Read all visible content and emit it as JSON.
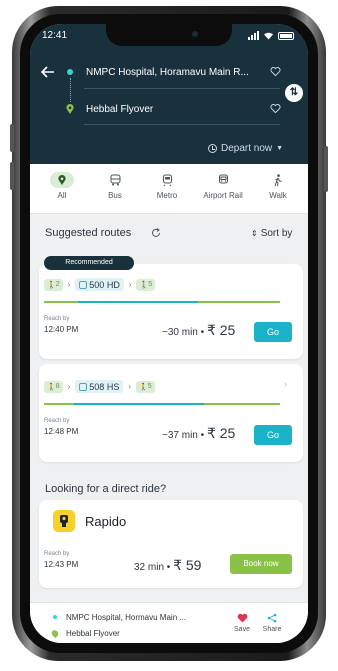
{
  "status_bar": {
    "time": "12:41"
  },
  "header": {
    "source": "NMPC Hospital, Horamavu Main R...",
    "destination": "Hebbal Flyover",
    "depart_label": "Depart now",
    "bg_color": "#19313d"
  },
  "modes": [
    {
      "label": "All",
      "icon": "pin-icon",
      "active": true
    },
    {
      "label": "Bus",
      "icon": "bus-icon",
      "active": false
    },
    {
      "label": "Metro",
      "icon": "metro-icon",
      "active": false
    },
    {
      "label": "Airport Rail",
      "icon": "airport-rail-icon",
      "active": false
    },
    {
      "label": "Walk",
      "icon": "walk-icon",
      "active": false
    }
  ],
  "suggested": {
    "title": "Suggested routes",
    "sort_label": "Sort by"
  },
  "routes": [
    {
      "badge": "Recommended",
      "walk_start": "2",
      "bus": "500 HD",
      "walk_end": "5",
      "reach_label": "Reach by",
      "reach_time": "12:40 PM",
      "duration": "~30 min",
      "dot": "•",
      "fare": "₹ 25",
      "go_label": "Go"
    },
    {
      "walk_start": "8",
      "bus": "508 HS",
      "walk_end": "5",
      "reach_label": "Reach by",
      "reach_time": "12:48 PM",
      "duration": "~37 min",
      "dot": "•",
      "fare": "₹ 25",
      "go_label": "Go"
    }
  ],
  "direct": {
    "title": "Looking for a direct ride?",
    "provider": "Rapido",
    "reach_label": "Reach by",
    "reach_time": "12:43 PM",
    "duration": "32 min",
    "dot": "•",
    "fare": "₹ 59",
    "book_label": "Book now"
  },
  "footer": {
    "source": "NMPC Hospital, Hormavu Main ...",
    "destination": "Hebbal Flyover",
    "save_label": "Save",
    "share_label": "Share"
  },
  "colors": {
    "accent": "#1bb3c9",
    "book": "#8ac247",
    "heart": "#e0334e"
  }
}
